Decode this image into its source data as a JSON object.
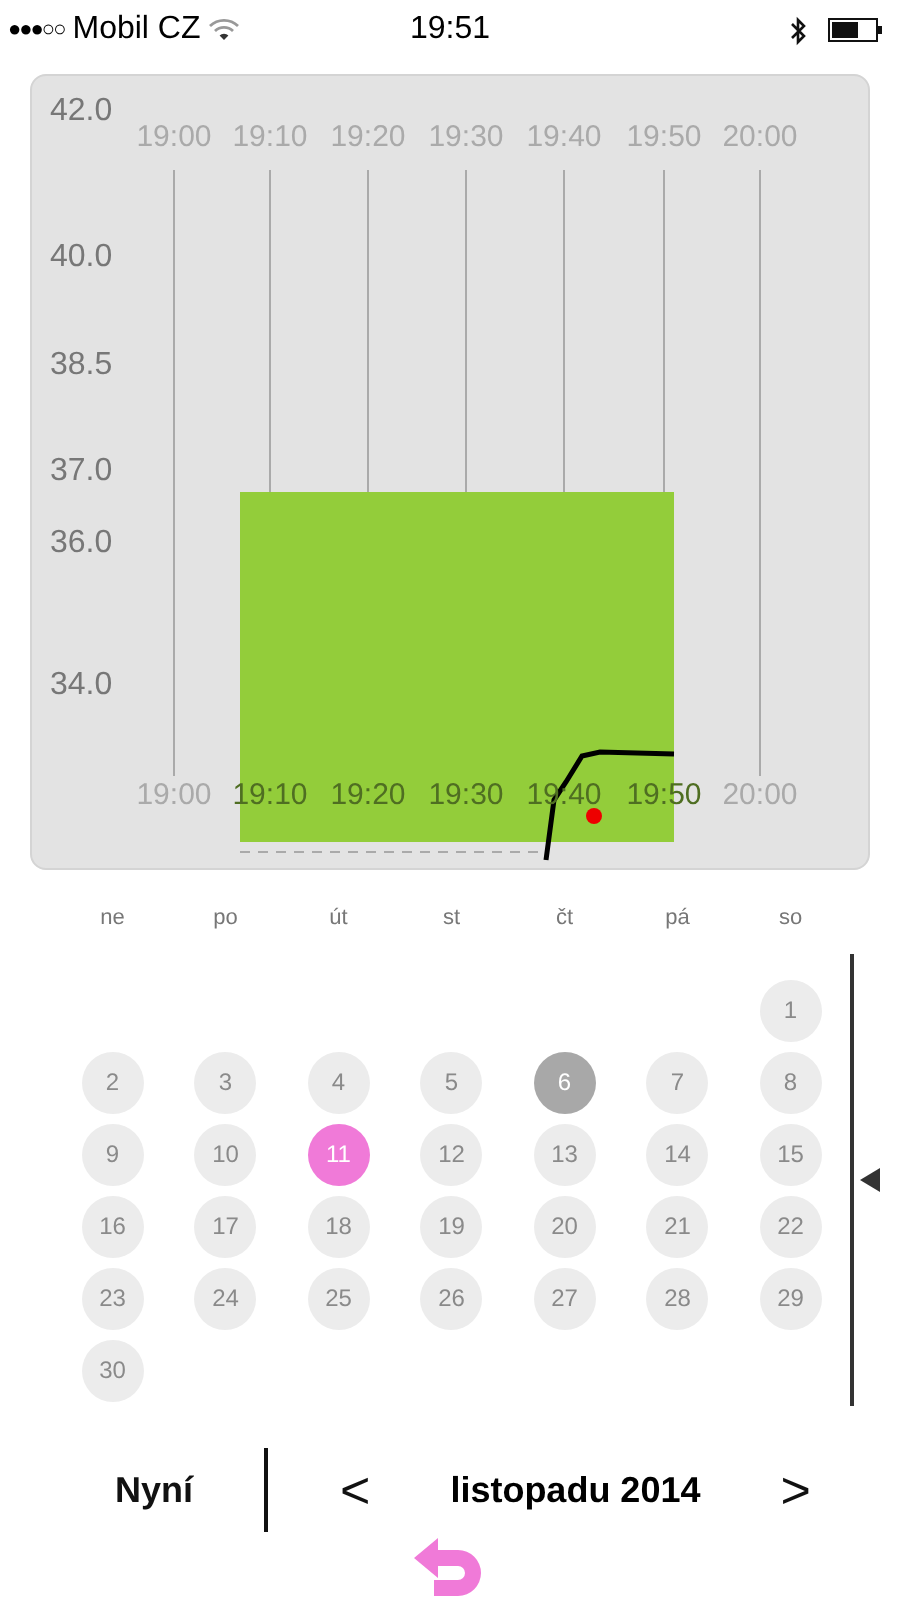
{
  "status_bar": {
    "carrier": "Mobil CZ",
    "time": "19:51",
    "signal_bars": "●●●○○"
  },
  "chart": {
    "y_labels": [
      "42.0",
      "40.0",
      "38.5",
      "37.0",
      "36.0",
      "34.0"
    ],
    "x_labels_top": [
      "19:00",
      "19:10",
      "19:20",
      "19:30",
      "19:40",
      "19:50",
      "20:00"
    ],
    "x_labels_bottom": [
      "19:00",
      "19:10",
      "19:20",
      "19:30",
      "19:40",
      "19:50",
      "20:00"
    ]
  },
  "calendar": {
    "weekdays": [
      "ne",
      "po",
      "út",
      "st",
      "čt",
      "pá",
      "so"
    ],
    "weeks": [
      {
        "kind": "end",
        "days": [
          {
            "day": "1",
            "selected": false,
            "marked": false
          }
        ]
      },
      {
        "kind": "start",
        "days": [
          {
            "day": "2",
            "selected": false,
            "marked": false
          },
          {
            "day": "3",
            "selected": false,
            "marked": false
          },
          {
            "day": "4",
            "selected": false,
            "marked": false
          },
          {
            "day": "5",
            "selected": false,
            "marked": false
          },
          {
            "day": "6",
            "selected": false,
            "marked": true
          },
          {
            "day": "7",
            "selected": false,
            "marked": false
          },
          {
            "day": "8",
            "selected": false,
            "marked": false
          }
        ]
      },
      {
        "kind": "start",
        "days": [
          {
            "day": "9",
            "selected": false,
            "marked": false
          },
          {
            "day": "10",
            "selected": false,
            "marked": false
          },
          {
            "day": "11",
            "selected": true,
            "marked": false
          },
          {
            "day": "12",
            "selected": false,
            "marked": false
          },
          {
            "day": "13",
            "selected": false,
            "marked": false
          },
          {
            "day": "14",
            "selected": false,
            "marked": false
          },
          {
            "day": "15",
            "selected": false,
            "marked": false
          }
        ]
      },
      {
        "kind": "start",
        "days": [
          {
            "day": "16",
            "selected": false,
            "marked": false
          },
          {
            "day": "17",
            "selected": false,
            "marked": false
          },
          {
            "day": "18",
            "selected": false,
            "marked": false
          },
          {
            "day": "19",
            "selected": false,
            "marked": false
          },
          {
            "day": "20",
            "selected": false,
            "marked": false
          },
          {
            "day": "21",
            "selected": false,
            "marked": false
          },
          {
            "day": "22",
            "selected": false,
            "marked": false
          }
        ]
      },
      {
        "kind": "start",
        "days": [
          {
            "day": "23",
            "selected": false,
            "marked": false
          },
          {
            "day": "24",
            "selected": false,
            "marked": false
          },
          {
            "day": "25",
            "selected": false,
            "marked": false
          },
          {
            "day": "26",
            "selected": false,
            "marked": false
          },
          {
            "day": "27",
            "selected": false,
            "marked": false
          },
          {
            "day": "28",
            "selected": false,
            "marked": false
          },
          {
            "day": "29",
            "selected": false,
            "marked": false
          }
        ]
      },
      {
        "kind": "start",
        "days": [
          {
            "day": "30",
            "selected": false,
            "marked": false
          }
        ]
      }
    ]
  },
  "footer": {
    "now_button": "Nyní",
    "prev": "<",
    "month": "listopadu 2014",
    "next": ">"
  }
}
